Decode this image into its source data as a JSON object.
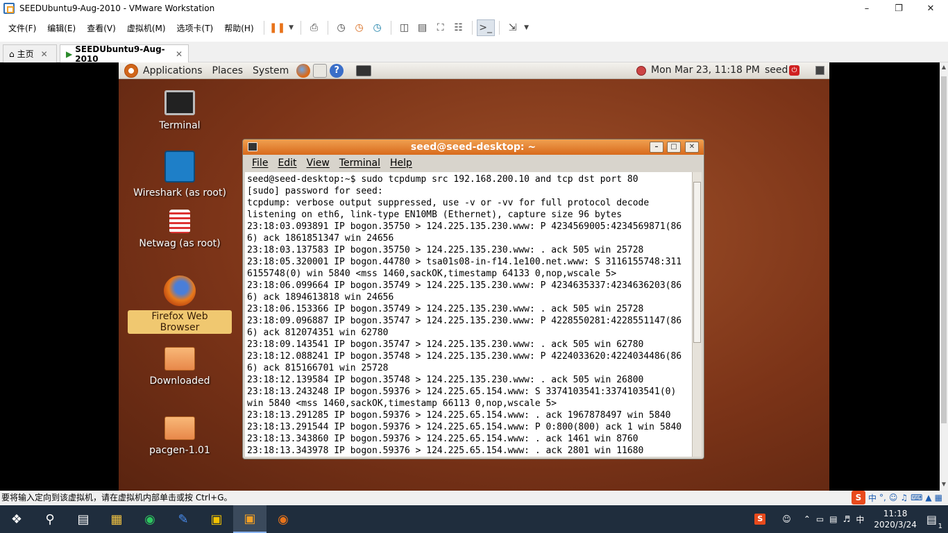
{
  "window": {
    "title": "SEEDUbuntu9-Aug-2010 - VMware Workstation"
  },
  "menubar": {
    "items": [
      "文件(F)",
      "编辑(E)",
      "查看(V)",
      "虚拟机(M)",
      "选项卡(T)",
      "帮助(H)"
    ]
  },
  "tabs": [
    {
      "label": "主页"
    },
    {
      "label": "SEEDUbuntu9-Aug-2010"
    }
  ],
  "guest": {
    "panel": {
      "menus": [
        "Applications",
        "Places",
        "System"
      ],
      "datetime": "Mon Mar 23, 11:18 PM",
      "user": "seed"
    },
    "desktop_icons": [
      {
        "label": "Terminal"
      },
      {
        "label": "Wireshark (as root)"
      },
      {
        "label": "Netwag (as root)"
      },
      {
        "label": "Firefox Web Browser"
      },
      {
        "label": "Downloaded"
      },
      {
        "label": "pacgen-1.01"
      }
    ],
    "terminal": {
      "title": "seed@seed-desktop: ~",
      "menus": [
        "File",
        "Edit",
        "View",
        "Terminal",
        "Help"
      ],
      "lines": [
        "seed@seed-desktop:~$ sudo tcpdump src 192.168.200.10 and tcp dst port 80",
        "[sudo] password for seed:",
        "tcpdump: verbose output suppressed, use -v or -vv for full protocol decode",
        "listening on eth6, link-type EN10MB (Ethernet), capture size 96 bytes",
        "23:18:03.093891 IP bogon.35750 > 124.225.135.230.www: P 4234569005:4234569871(86",
        "6) ack 1861851347 win 24656",
        "23:18:03.137583 IP bogon.35750 > 124.225.135.230.www: . ack 505 win 25728",
        "23:18:05.320001 IP bogon.44780 > tsa01s08-in-f14.1e100.net.www: S 3116155748:311",
        "6155748(0) win 5840 <mss 1460,sackOK,timestamp 64133 0,nop,wscale 5>",
        "23:18:06.099664 IP bogon.35749 > 124.225.135.230.www: P 4234635337:4234636203(86",
        "6) ack 1894613818 win 24656",
        "23:18:06.153366 IP bogon.35749 > 124.225.135.230.www: . ack 505 win 25728",
        "23:18:09.096887 IP bogon.35747 > 124.225.135.230.www: P 4228550281:4228551147(86",
        "6) ack 812074351 win 62780",
        "23:18:09.143541 IP bogon.35747 > 124.225.135.230.www: . ack 505 win 62780",
        "23:18:12.088241 IP bogon.35748 > 124.225.135.230.www: P 4224033620:4224034486(86",
        "6) ack 815166701 win 25728",
        "23:18:12.139584 IP bogon.35748 > 124.225.135.230.www: . ack 505 win 26800",
        "23:18:13.243248 IP bogon.59376 > 124.225.65.154.www: S 3374103541:3374103541(0)",
        "win 5840 <mss 1460,sackOK,timestamp 66113 0,nop,wscale 5>",
        "23:18:13.291285 IP bogon.59376 > 124.225.65.154.www: . ack 1967878497 win 5840",
        "23:18:13.291544 IP bogon.59376 > 124.225.65.154.www: P 0:800(800) ack 1 win 5840",
        "23:18:13.343860 IP bogon.59376 > 124.225.65.154.www: . ack 1461 win 8760",
        "23:18:13.343978 IP bogon.59376 > 124.225.65.154.www: . ack 2801 win 11680"
      ]
    }
  },
  "statusbar": {
    "text": "要将输入定向到该虚拟机，请在虚拟机内部单击或按 Ctrl+G。"
  },
  "ime": {
    "label": "中"
  },
  "taskbar": {
    "ime_indicator": "中",
    "time": "11:18",
    "date": "2020/3/24",
    "notification_count": "1"
  },
  "colors": {
    "ubuntu_orange": "#d86a1c",
    "taskbar_bg": "#1f2d3d",
    "desktop_brown": "#7c3418"
  }
}
